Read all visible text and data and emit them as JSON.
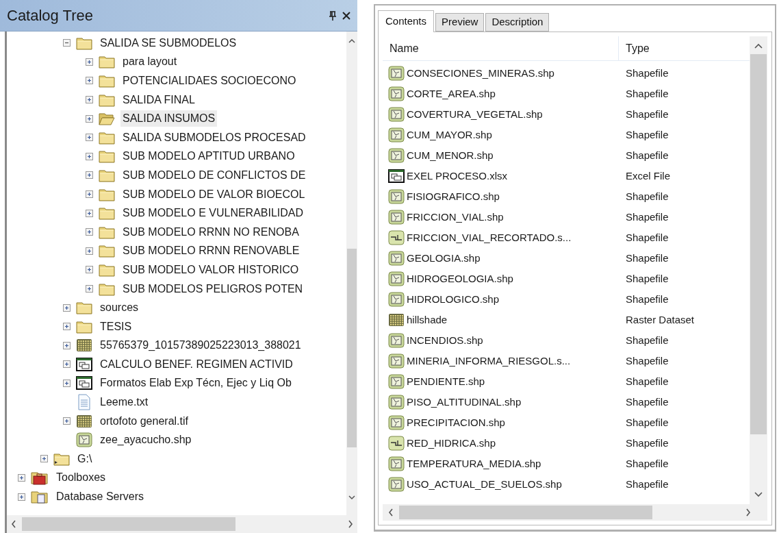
{
  "catalog_tree": {
    "title": "Catalog Tree",
    "items": [
      {
        "children": [
          {
            "children": [
              {
                "label": "SALIDA SE SUBMODELOS",
                "kind": "folder",
                "expanded": true,
                "selected": false,
                "children": [
                  {
                    "label": "para layout",
                    "kind": "folder",
                    "expanded": false,
                    "selected": false
                  },
                  {
                    "label": "POTENCIALIDAES SOCIOECONO",
                    "kind": "folder",
                    "expanded": false,
                    "selected": false
                  },
                  {
                    "label": "SALIDA FINAL",
                    "kind": "folder",
                    "expanded": false,
                    "selected": false
                  },
                  {
                    "label": "SALIDA INSUMOS",
                    "kind": "folder_open",
                    "expanded": false,
                    "selected": true
                  },
                  {
                    "label": "SALIDA SUBMODELOS PROCESAD",
                    "kind": "folder",
                    "expanded": false,
                    "selected": false
                  },
                  {
                    "label": "SUB MODELO APTITUD URBANO",
                    "kind": "folder",
                    "expanded": false,
                    "selected": false
                  },
                  {
                    "label": "SUB MODELO DE CONFLICTOS DE",
                    "kind": "folder",
                    "expanded": false,
                    "selected": false
                  },
                  {
                    "label": "SUB MODELO DE VALOR BIOECOL",
                    "kind": "folder",
                    "expanded": false,
                    "selected": false
                  },
                  {
                    "label": "SUB MODELO E VULNERABILIDAD",
                    "kind": "folder",
                    "expanded": false,
                    "selected": false
                  },
                  {
                    "label": "SUB MODELO RRNN NO RENOBA",
                    "kind": "folder",
                    "expanded": false,
                    "selected": false
                  },
                  {
                    "label": "SUB MODELO RRNN RENOVABLE",
                    "kind": "folder",
                    "expanded": false,
                    "selected": false
                  },
                  {
                    "label": "SUB MODELO VALOR HISTORICO",
                    "kind": "folder",
                    "expanded": false,
                    "selected": false
                  },
                  {
                    "label": "SUB MODELOS PELIGROS POTEN",
                    "kind": "folder",
                    "expanded": false,
                    "selected": false
                  }
                ]
              },
              {
                "label": "sources",
                "kind": "folder",
                "expanded": false,
                "selected": false
              },
              {
                "label": "TESIS",
                "kind": "folder",
                "expanded": false,
                "selected": false
              },
              {
                "label": "55765379_10157389025223013_388021",
                "kind": "raster",
                "expanded": false,
                "selected": false
              },
              {
                "label": "CALCULO BENEF. REGIMEN ACTIVID",
                "kind": "table",
                "expanded": false,
                "selected": false
              },
              {
                "label": "Formatos Elab Exp Técn, Ejec y Liq Ob",
                "kind": "table",
                "expanded": false,
                "selected": false
              },
              {
                "label": "Leeme.txt",
                "kind": "text",
                "selected": false
              },
              {
                "label": "ortofoto general.tif",
                "kind": "raster",
                "expanded": false,
                "selected": false
              },
              {
                "label": "zee_ayacucho.shp",
                "kind": "polygon",
                "selected": false
              }
            ]
          },
          {
            "label": "G:\\",
            "kind": "drive",
            "expanded": false,
            "selected": false
          }
        ]
      },
      {
        "label": "Toolboxes",
        "kind": "toolbox",
        "expanded": false,
        "selected": false
      },
      {
        "label": "Database Servers",
        "kind": "database",
        "expanded": false,
        "selected": false
      }
    ]
  },
  "contents": {
    "tabs": [
      {
        "label": "Contents",
        "selected": true
      },
      {
        "label": "Preview",
        "selected": false
      },
      {
        "label": "Description",
        "selected": false
      }
    ],
    "columns": [
      "Name",
      "Type"
    ],
    "rows": [
      {
        "name": "CONSECIONES_MINERAS.shp",
        "type": "Shapefile",
        "kind": "polygon"
      },
      {
        "name": "CORTE_AREA.shp",
        "type": "Shapefile",
        "kind": "polygon"
      },
      {
        "name": "COVERTURA_VEGETAL.shp",
        "type": "Shapefile",
        "kind": "polygon"
      },
      {
        "name": "CUM_MAYOR.shp",
        "type": "Shapefile",
        "kind": "polygon"
      },
      {
        "name": "CUM_MENOR.shp",
        "type": "Shapefile",
        "kind": "polygon"
      },
      {
        "name": "EXEL PROCESO.xlsx",
        "type": "Excel File",
        "kind": "table"
      },
      {
        "name": "FISIOGRAFICO.shp",
        "type": "Shapefile",
        "kind": "polygon"
      },
      {
        "name": "FRICCION_VIAL.shp",
        "type": "Shapefile",
        "kind": "polygon"
      },
      {
        "name": "FRICCION_VIAL_RECORTADO.s...",
        "type": "Shapefile",
        "kind": "line"
      },
      {
        "name": "GEOLOGIA.shp",
        "type": "Shapefile",
        "kind": "polygon"
      },
      {
        "name": "HIDROGEOLOGIA.shp",
        "type": "Shapefile",
        "kind": "polygon"
      },
      {
        "name": "HIDROLOGICO.shp",
        "type": "Shapefile",
        "kind": "polygon"
      },
      {
        "name": "hillshade",
        "type": "Raster Dataset",
        "kind": "raster"
      },
      {
        "name": "INCENDIOS.shp",
        "type": "Shapefile",
        "kind": "polygon"
      },
      {
        "name": "MINERIA_INFORMA_RIESGOL.s...",
        "type": "Shapefile",
        "kind": "polygon"
      },
      {
        "name": "PENDIENTE.shp",
        "type": "Shapefile",
        "kind": "polygon"
      },
      {
        "name": "PISO_ALTITUDINAL.shp",
        "type": "Shapefile",
        "kind": "polygon"
      },
      {
        "name": "PRECIPITACION.shp",
        "type": "Shapefile",
        "kind": "polygon"
      },
      {
        "name": "RED_HIDRICA.shp",
        "type": "Shapefile",
        "kind": "line"
      },
      {
        "name": "TEMPERATURA_MEDIA.shp",
        "type": "Shapefile",
        "kind": "polygon"
      },
      {
        "name": "USO_ACTUAL_DE_SUELOS.shp",
        "type": "Shapefile",
        "kind": "polygon"
      }
    ]
  }
}
